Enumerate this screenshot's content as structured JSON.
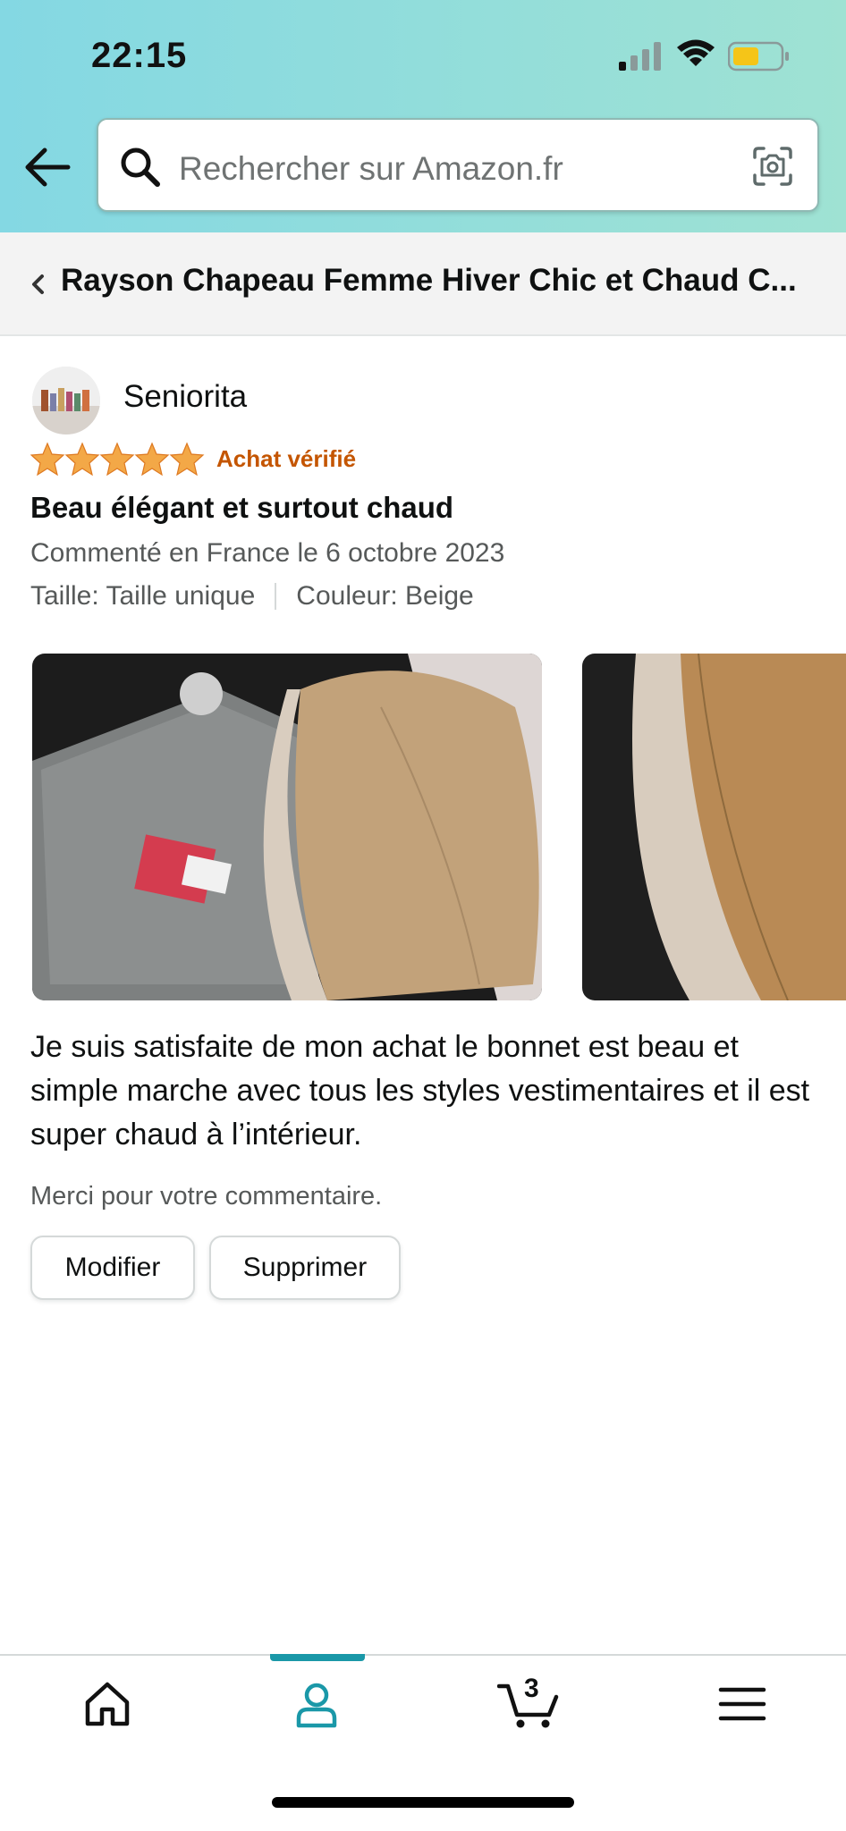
{
  "status_bar": {
    "time": "22:15"
  },
  "search": {
    "placeholder": "Rechercher sur Amazon.fr"
  },
  "breadcrumb": {
    "title": "Rayson Chapeau Femme Hiver Chic et Chaud C..."
  },
  "review": {
    "author": "Seniorita",
    "rating": 5,
    "rating_max": 5,
    "verified_label": "Achat vérifié",
    "title": "Beau élégant et surtout chaud",
    "date": "Commenté en France le 6 octobre 2023",
    "size": "Taille: Taille unique",
    "color": "Couleur: Beige",
    "body": "Je suis satisfaite de mon achat le bonnet est beau et simple marche avec tous les styles vestimentaires et il est super chaud à l’intérieur.",
    "thanks": "Merci pour votre commentaire."
  },
  "actions": {
    "edit_label": "Modifier",
    "delete_label": "Supprimer"
  },
  "colors": {
    "star": "#f3a847",
    "verified": "#c45500",
    "accent": "#1a98a8"
  },
  "nav": {
    "cart_count": "3",
    "items": [
      "home-icon",
      "account-icon",
      "cart-icon",
      "menu-icon"
    ],
    "active": "account-icon"
  }
}
